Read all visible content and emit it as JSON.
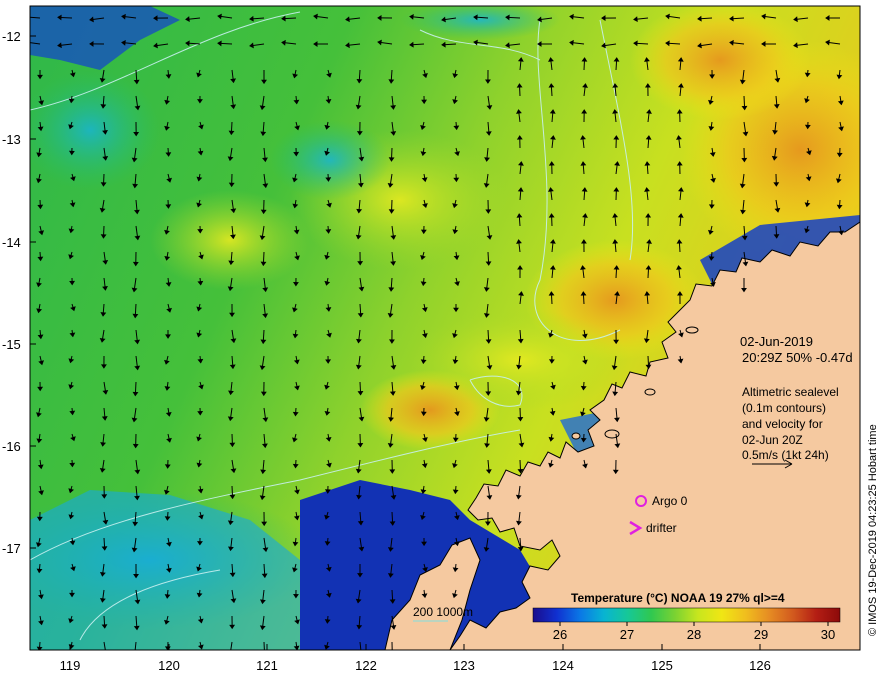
{
  "map": {
    "lat_ticks": [
      "-12",
      "-13",
      "-14",
      "-15",
      "-16",
      "-17"
    ],
    "lon_ticks": [
      "119",
      "120",
      "121",
      "122",
      "123",
      "124",
      "125",
      "126"
    ],
    "land_color": "#f5c9a0",
    "coast_color": "#000000"
  },
  "info": {
    "date": "02-Jun-2019",
    "pass": "20:29Z  50% -0.47d",
    "alt_line1": "Altimetric sealevel",
    "alt_line2": "(0.1m contours)",
    "alt_line3": "and velocity for",
    "alt_line4": "02-Jun 20Z",
    "alt_line5": "0.5m/s (1kt 24h)"
  },
  "legend": {
    "argo_label": "Argo 0",
    "drifter_label": "drifter",
    "argo_color": "#e020e0",
    "drifter_color": "#e020e0"
  },
  "scale": {
    "label": "200  1000m",
    "color": "#80e0e0"
  },
  "colorbar": {
    "title": "Temperature (°C) NOAA 19 27% ql>=4",
    "ticks": [
      "26",
      "27",
      "28",
      "29",
      "30"
    ],
    "colors": [
      "#1a0d8c",
      "#1030d0",
      "#0a78e6",
      "#08b4d2",
      "#16c898",
      "#30c850",
      "#7ad232",
      "#c8e61e",
      "#f0e614",
      "#f0be1e",
      "#e68c23",
      "#d25a1e",
      "#b41e14",
      "#8c0a0a"
    ]
  },
  "credit": "© IMOS 19-Dec-2019 04:23:25 Hobart time"
}
